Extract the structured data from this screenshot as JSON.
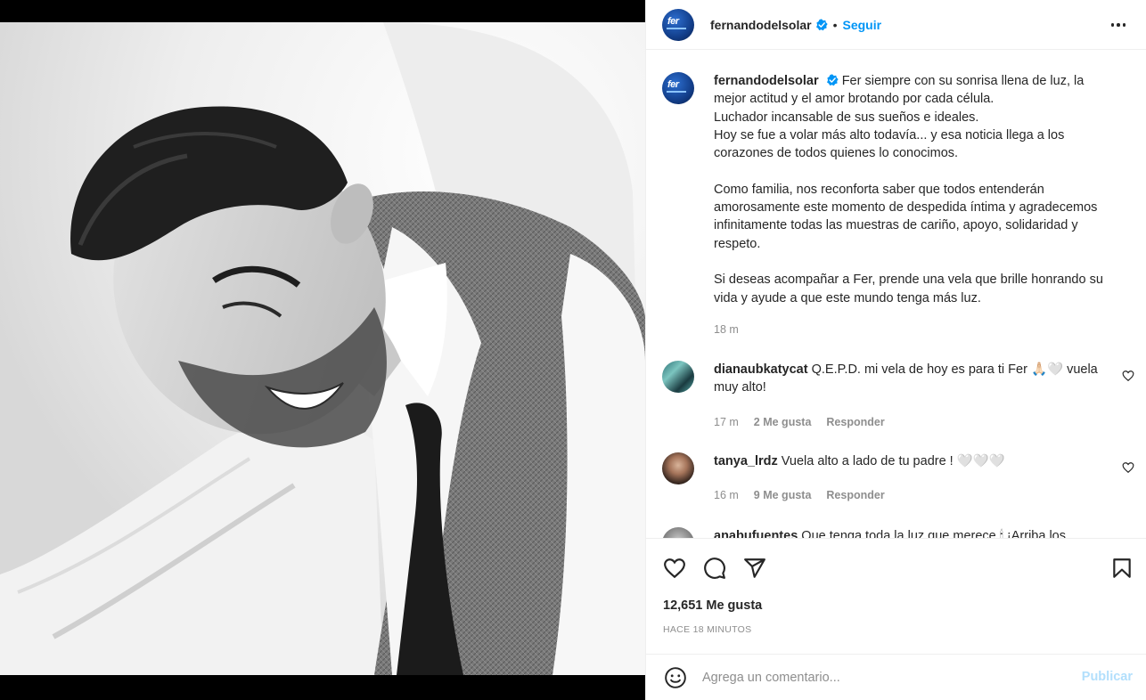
{
  "post": {
    "username": "fernandodelsolar",
    "follow_label": "Seguir",
    "separator": "•",
    "avatar_text": "fer"
  },
  "caption": {
    "username": "fernandodelsolar",
    "paragraphs": [
      "Fer siempre con su sonrisa llena de luz, la mejor actitud y el amor brotando por cada célula.",
      "Luchador incansable de sus sueños e ideales.",
      "Hoy se fue a volar más alto todavía... y esa noticia llega a los corazones de todos quienes lo conocimos.",
      "Como familia, nos reconforta saber que todos entenderán amorosamente este momento de despedida íntima y agradecemos infinitamente todas las muestras de cariño, apoyo, solidaridad y respeto.",
      "Si deseas acompañar a Fer, prende una vela que brille honrando su vida y ayude a que este mundo tenga más luz."
    ],
    "time": "18 m"
  },
  "comments": [
    {
      "username": "dianaubkatycat",
      "text": "Q.E.P.D. mi vela de hoy es para ti Fer 🙏🏻🤍 vuela muy alto!",
      "time": "17 m",
      "likes": "2 Me gusta",
      "reply": "Responder"
    },
    {
      "username": "tanya_lrdz",
      "text": "Vuela alto a lado de tu padre ! 🤍🤍🤍",
      "time": "16 m",
      "likes": "9 Me gusta",
      "reply": "Responder"
    },
    {
      "username": "anabufuentes",
      "text": "Que tenga toda la luz que merece 🕯 ¡Arriba los"
    }
  ],
  "stats": {
    "likes": "12,651 Me gusta",
    "ago": "HACE 18 MINUTOS"
  },
  "composer": {
    "placeholder": "Agrega un comentario...",
    "publish": "Publicar"
  },
  "colors": {
    "accent": "#0095f6",
    "publish_disabled": "#b2dffc",
    "muted": "#8e8e8e",
    "text": "#262626"
  },
  "icons": [
    "verified-badge-icon",
    "more-options-icon",
    "heart-icon",
    "comment-icon",
    "share-icon",
    "bookmark-icon",
    "emoji-icon"
  ]
}
